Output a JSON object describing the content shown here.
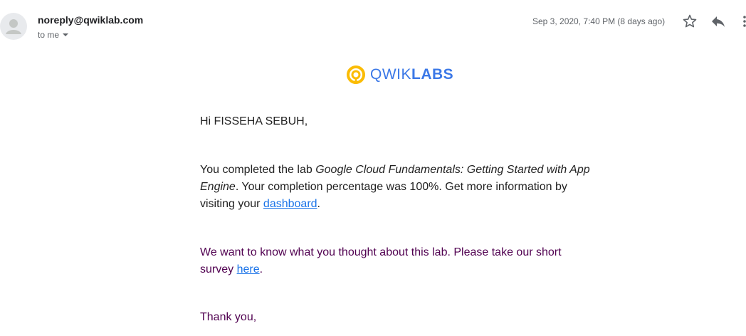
{
  "header": {
    "sender": "noreply@qwiklab.com",
    "to_label": "to me",
    "date": "Sep 3, 2020, 7:40 PM (8 days ago)"
  },
  "logo": {
    "text_regular": "QWIK",
    "text_bold": "LABS"
  },
  "body": {
    "greeting": "Hi FISSEHA SEBUH,",
    "p1_a": "You completed the lab ",
    "p1_lab_name": "Google Cloud Fundamentals: Getting Started with App Engine",
    "p1_b": ". Your completion percentage was 100%. Get more information by visiting your ",
    "p1_link": "dashboard",
    "p1_c": ".",
    "p2_a": "We want to know what you thought about this lab. Please take our short survey ",
    "p2_link": "here",
    "p2_b": ".",
    "thanks": "Thank you,"
  },
  "colors": {
    "logo_yellow": "#fbbc04",
    "logo_blue": "#3b78e7",
    "link": "#1a73e8",
    "quoted_purple": "#500050"
  },
  "icons": [
    "avatar-icon",
    "caret-down-icon",
    "star-icon",
    "reply-icon",
    "more-vert-icon",
    "qwiklabs-logo-icon"
  ]
}
